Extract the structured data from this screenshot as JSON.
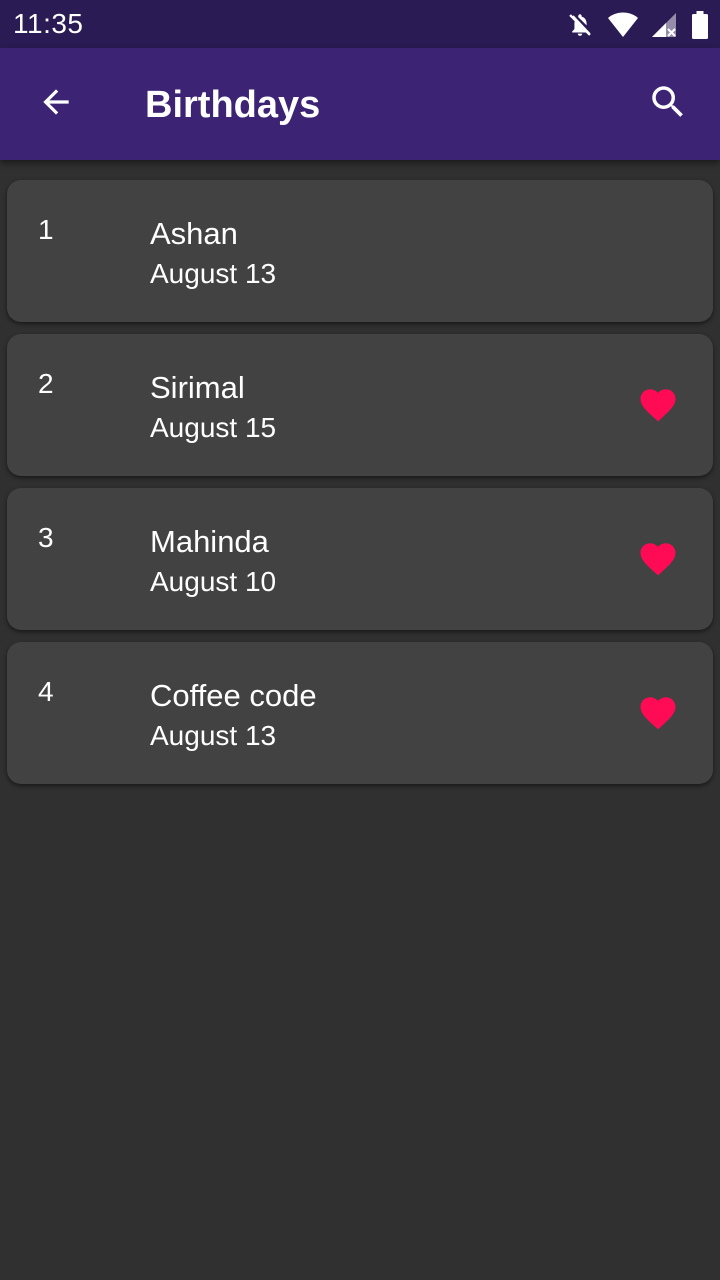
{
  "status_bar": {
    "time": "11:35",
    "icons": [
      "notifications-off-icon",
      "wifi-icon",
      "signal-icon",
      "battery-icon"
    ]
  },
  "app_bar": {
    "title": "Birthdays",
    "back_icon": "arrow-back-icon",
    "search_icon": "search-icon",
    "background": "#3c2374"
  },
  "birthdays": [
    {
      "index": "1",
      "name": "Ashan",
      "date": "August 13",
      "favorite": false
    },
    {
      "index": "2",
      "name": "Sirimal",
      "date": "August 15",
      "favorite": true
    },
    {
      "index": "3",
      "name": "Mahinda",
      "date": "August 10",
      "favorite": true
    },
    {
      "index": "4",
      "name": "Coffee code",
      "date": "August 13",
      "favorite": true
    }
  ],
  "colors": {
    "status_bar": "#2a1b54",
    "background": "#303030",
    "card": "#424242",
    "heart": "#ff0a55"
  }
}
